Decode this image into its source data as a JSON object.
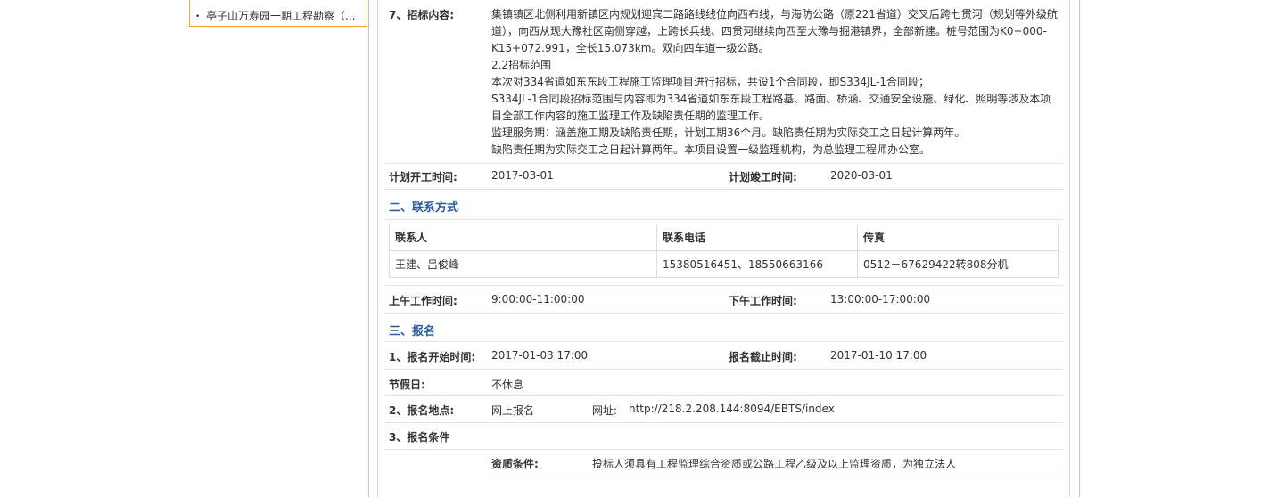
{
  "sidebar": {
    "items": [
      {
        "label": "亭子山万寿园一期工程勘察（..."
      }
    ]
  },
  "section7": {
    "label": "7、招标内容:",
    "lines": [
      "集镇镇区北侧利用新镇区内规划迎宾二路路线线位向西布线，与海防公路（原221省道）交叉后跨七贯河（规划等外级航",
      "道），向西从现大豫社区南侧穿越，上跨长兵线、四贯河继续向西至大豫与掘港镇界，全部新建。桩号范围为K0+000-",
      "K15+072.991，全长15.073km。双向四车道一级公路。",
      "2.2招标范围",
      "本次对334省道如东东段工程施工监理项目进行招标，共设1个合同段，即S334JL-1合同段；",
      "S334JL-1合同段招标范围与内容即为334省道如东东段工程路基、路面、桥涵、交通安全设施、绿化、照明等涉及本项",
      "目全部工作内容的施工监理工作及缺陷责任期的监理工作。",
      "监理服务期：涵盖施工期及缺陷责任期，计划工期36个月。缺陷责任期为实际交工之日起计算两年。",
      "缺陷责任期为实际交工之日起计算两年。本项目设置一级监理机构，为总监理工程师办公室。"
    ]
  },
  "schedule": {
    "start_label": "计划开工时间:",
    "start_value": "2017-03-01",
    "end_label": "计划竣工时间:",
    "end_value": "2020-03-01"
  },
  "contact": {
    "section_title": "二、联系方式",
    "headers": [
      "联系人",
      "联系电话",
      "传真"
    ],
    "rows": [
      [
        "王建、吕俊峰",
        "15380516451、18550663166",
        "0512－67629422转808分机"
      ]
    ]
  },
  "work_hours": {
    "am_label": "上午工作时间:",
    "am_value": "9:00:00-11:00:00",
    "pm_label": "下午工作时间:",
    "pm_value": "13:00:00-17:00:00"
  },
  "registration": {
    "section_title": "三、报名",
    "start_label": "1、报名开始时间:",
    "start_value": "2017-01-03 17:00",
    "end_label": "报名截止时间:",
    "end_value": "2017-01-10 17:00",
    "holiday_label": "节假日:",
    "holiday_value": "不休息",
    "place_label": "2、报名地点:",
    "place_value": "网上报名",
    "url_label": "网址:",
    "url_value": "http://218.2.208.144:8094/EBTS/index",
    "conditions_label": "3、报名条件",
    "qual_label": "资质条件:",
    "qual_value": "投标人须具有工程监理综合资质或公路工程乙级及以上监理资质，为独立法人"
  }
}
